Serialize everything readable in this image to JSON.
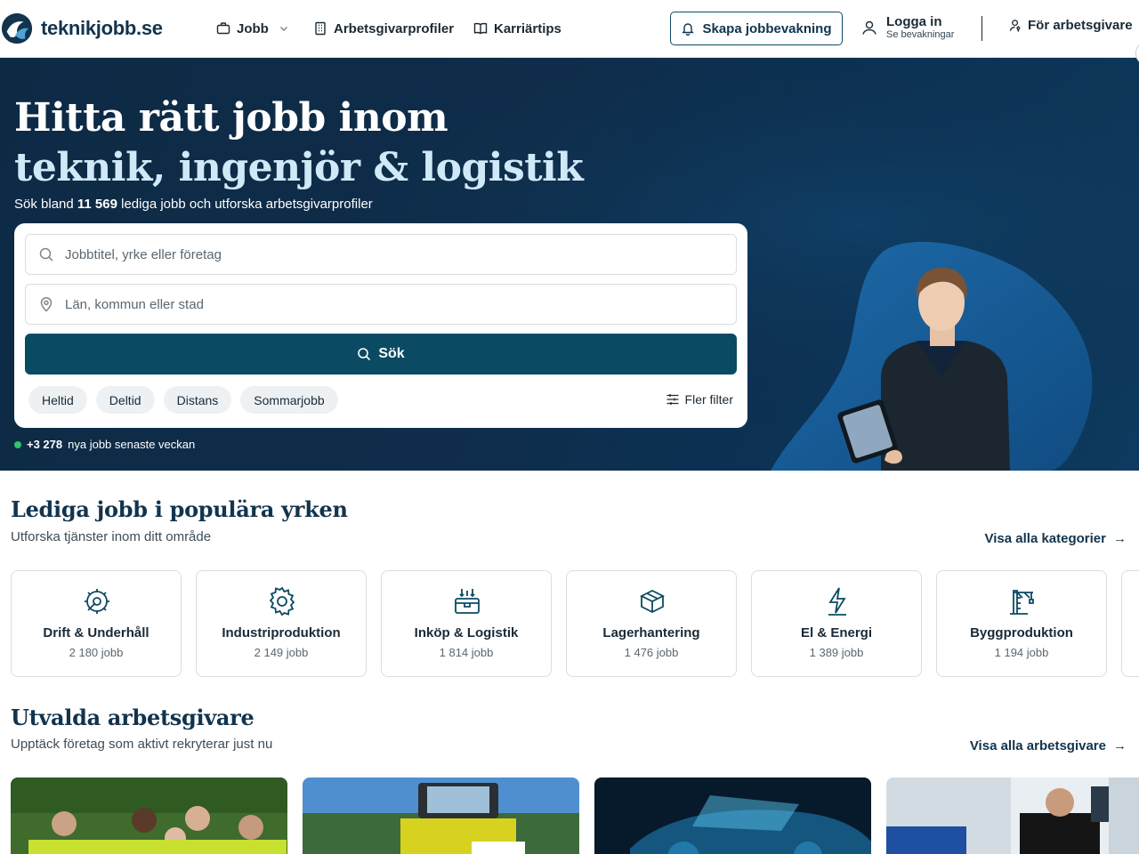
{
  "header": {
    "logo_text": "teknikjobb.se",
    "nav": {
      "jobb": "Jobb",
      "arbetsgivarprofiler": "Arbetsgivarprofiler",
      "karriartips": "Karriärtips"
    },
    "alert_button": "Skapa jobbevakning",
    "login_title": "Logga in",
    "login_sub": "Se bevakningar",
    "employers": "För arbetsgivare"
  },
  "hero": {
    "title_line1": "Hitta rätt jobb inom",
    "title_line2": "teknik, ingenjör & logistik",
    "sub_prefix": "Sök bland",
    "job_count": "11 569",
    "sub_suffix": "lediga jobb och utforska arbetsgivarprofiler",
    "search_placeholder": "Jobbtitel, yrke eller företag",
    "location_placeholder": "Län, kommun eller stad",
    "search_button": "Sök",
    "chips": [
      "Heltid",
      "Deltid",
      "Distans",
      "Sommarjobb"
    ],
    "more_filters": "Fler filter",
    "new_jobs_count": "+3 278",
    "new_jobs_text": "nya jobb senaste veckan"
  },
  "categories": {
    "title": "Lediga jobb i populära yrken",
    "subtitle": "Utforska tjänster inom ditt område",
    "link": "Visa alla kategorier",
    "items": [
      {
        "name": "Drift & Underhåll",
        "count": "2 180 jobb",
        "icon": "wrench-gear-icon"
      },
      {
        "name": "Industriproduktion",
        "count": "2 149 jobb",
        "icon": "gear-icon"
      },
      {
        "name": "Inköp & Logistik",
        "count": "1 814 jobb",
        "icon": "package-icon"
      },
      {
        "name": "Lagerhantering",
        "count": "1 476 jobb",
        "icon": "box-icon"
      },
      {
        "name": "El & Energi",
        "count": "1 389 jobb",
        "icon": "lightning-icon"
      },
      {
        "name": "Byggproduktion",
        "count": "1 194 jobb",
        "icon": "crane-icon"
      }
    ]
  },
  "employers": {
    "title": "Utvalda arbetsgivare",
    "subtitle": "Upptäck företag som aktivt rekryterar just nu",
    "link": "Visa alla arbetsgivare"
  },
  "colors": {
    "brand_dark": "#12344d",
    "button": "#0b4a63",
    "hero_bg": "#0f2d4a",
    "accent_green": "#2fc46b"
  }
}
